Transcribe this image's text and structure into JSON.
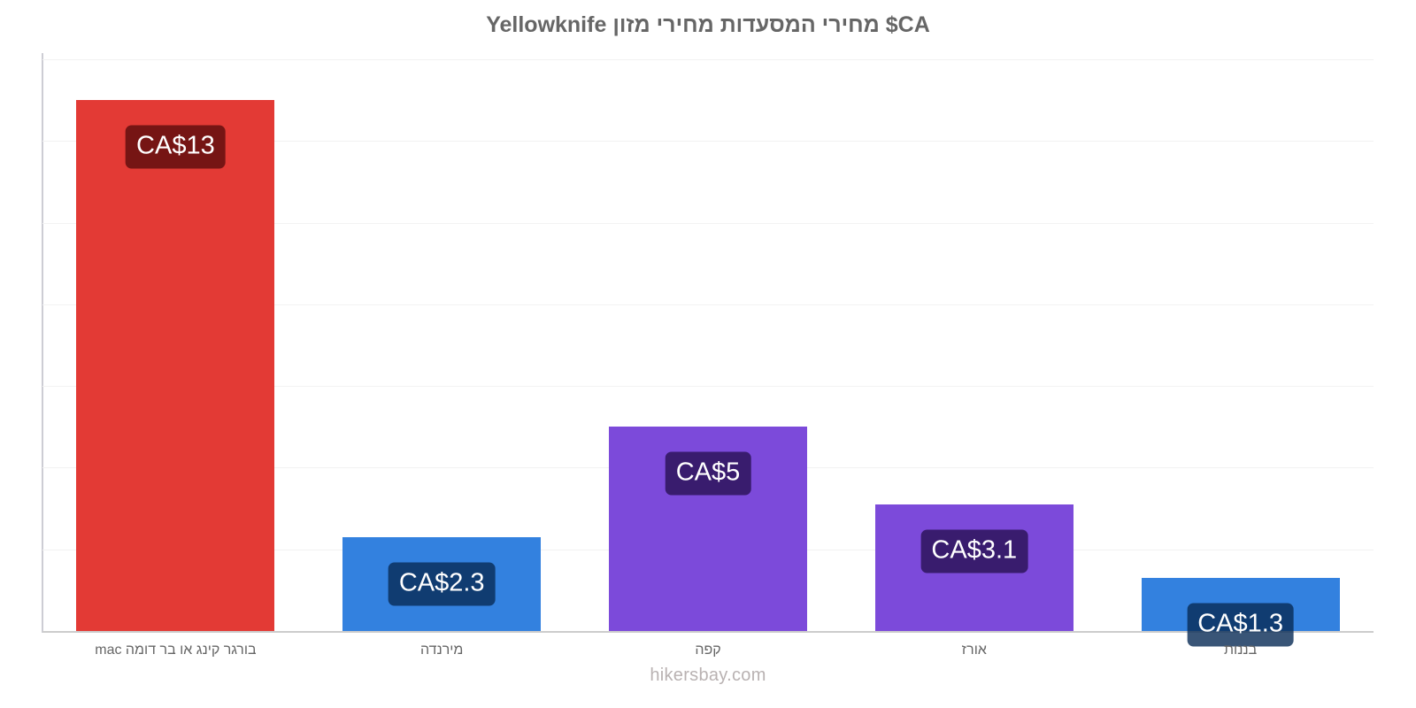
{
  "chart_data": {
    "type": "bar",
    "title": "CA$ מחירי המסעדות מחירי מזון Yellowknife",
    "xlabel": "",
    "ylabel": "",
    "ylim": [
      0,
      14
    ],
    "yticks": [
      0,
      2,
      4,
      6,
      8,
      10,
      12,
      14
    ],
    "ytick_labels": [
      "0",
      "2",
      "4",
      "6",
      "8",
      "10",
      "12",
      "14"
    ],
    "grid": true,
    "legend": "none",
    "currency_prefix": "CA$",
    "categories": [
      "בורגר קינג או בר דומה mac",
      "מירנדה",
      "קפה",
      "אורז",
      "בננות"
    ],
    "values": [
      13,
      2.3,
      5,
      3.1,
      1.3
    ],
    "data_labels": [
      "CA$13",
      "CA$2.3",
      "CA$5",
      "CA$3.1",
      "CA$1.3"
    ],
    "bar_colors": [
      "#e33a35",
      "#3381df",
      "#7c4ada",
      "#7c4ada",
      "#3381df"
    ],
    "label_bg_variants": [
      "on-red",
      "on-blue",
      "on-purple",
      "on-purple",
      "on-blue"
    ]
  },
  "footer": {
    "watermark": "hikersbay.com"
  },
  "colors": {
    "red": "#e33a35",
    "blue": "#3381df",
    "purple": "#7c4ada",
    "axis": "#cdcdd4",
    "grid": "#f2f2f2",
    "text": "#666666"
  }
}
